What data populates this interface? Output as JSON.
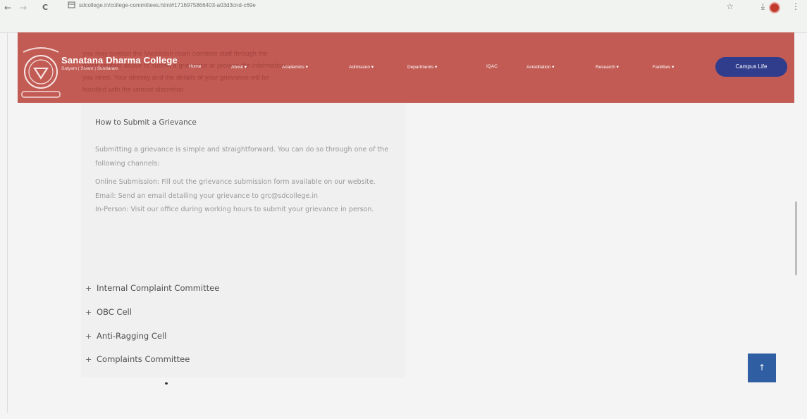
{
  "browser": {
    "url": "sdcollege.in/college-committees.html#1716975866403-a03d3cnd-c69e",
    "nav_icons": {
      "back": "←",
      "forward": "→",
      "reload": "C"
    },
    "right_icons": {
      "bookmark": "☆",
      "download": "⤓",
      "menu": "⋮"
    }
  },
  "header": {
    "ghost_lines": [
      "you may contact the Mediation room comittee staff through the",
      "given contact above to submit a grievance or provide the information",
      "you need. Your identity and the details of your grievance will be",
      "handled with the utmost discretion."
    ],
    "brand_name": "Sanatana Dharma College",
    "brand_motto": "Satyam | Sivam | Sundaram",
    "nav": [
      "Home",
      "About ▾",
      "Academics ▾",
      "Admission ▾",
      "Departments ▾",
      "IQAC",
      "Acreditation ▾",
      "Research ▾",
      "Facilities ▾"
    ],
    "cta": "Campus Life",
    "colors": {
      "bar": "#c25b54",
      "cta": "#2f3d8c"
    }
  },
  "content": {
    "heading": "How to Submit a Grievance",
    "intro": "Submitting a grievance is simple and straightforward. You can do so through one of the following channels:",
    "channels": [
      "Online Submission: Fill out the grievance submission form available on our website.",
      "Email: Send an email detailing your grievance to grc@sdcollege.in",
      "In-Person: Visit our office during working hours to submit your grievance in person."
    ],
    "accordion": [
      "Internal Complaint Committee",
      "OBC Cell",
      "Anti-Ragging Cell",
      "Complaints Committee"
    ],
    "accordion_icon": "+",
    "scroll_top_icon": "↑"
  }
}
